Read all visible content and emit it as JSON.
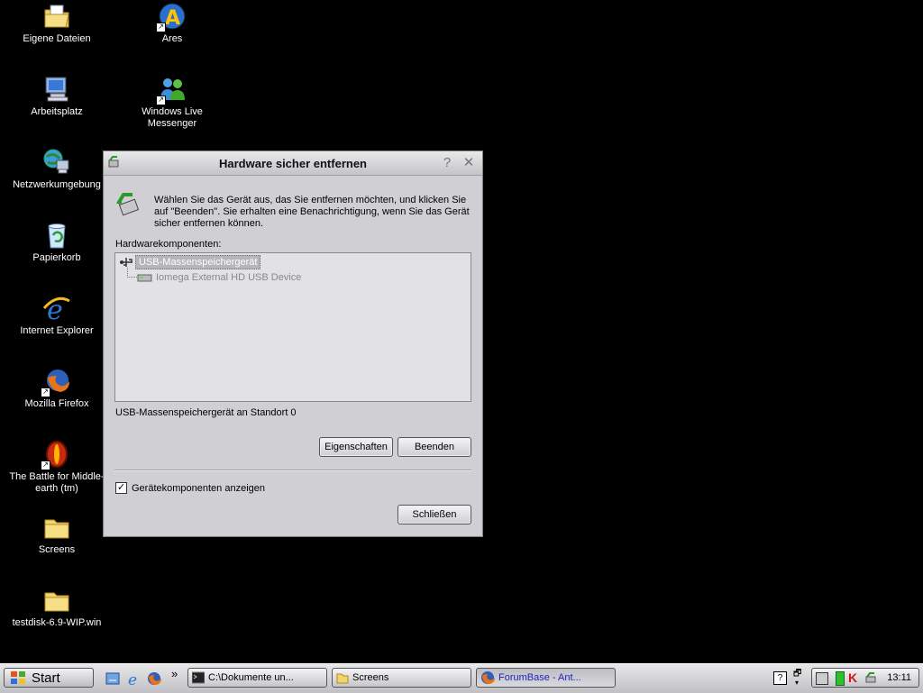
{
  "desktop": {
    "icons": [
      {
        "label": "Eigene Dateien",
        "icon": "folder-documents-icon"
      },
      {
        "label": "Arbeitsplatz",
        "icon": "computer-icon"
      },
      {
        "label": "Netzwerkumgebung",
        "icon": "network-icon"
      },
      {
        "label": "Papierkorb",
        "icon": "recycle-bin-icon"
      },
      {
        "label": "Internet Explorer",
        "icon": "ie-icon"
      },
      {
        "label": "Mozilla Firefox",
        "icon": "firefox-icon"
      },
      {
        "label": "The Battle for Middle-earth (tm)",
        "icon": "game-icon"
      },
      {
        "label": "Screens",
        "icon": "folder-icon"
      },
      {
        "label": "testdisk-6.9-WIP.win",
        "icon": "folder-icon"
      },
      {
        "label": "Ares",
        "icon": "ares-icon"
      },
      {
        "label": "Windows Live Messenger",
        "icon": "messenger-icon"
      }
    ]
  },
  "dialog": {
    "title": "Hardware sicher entfernen",
    "help_glyph": "?",
    "close_glyph": "✕",
    "intro": "Wählen Sie das Gerät aus, das Sie entfernen möchten, und klicken Sie auf \"Beenden\". Sie erhalten eine Benachrichtigung, wenn Sie das Gerät sicher entfernen können.",
    "hardware_label": "Hardwarekomponenten:",
    "tree": {
      "device": "USB-Massenspeichergerät",
      "child": "Iomega External HD USB Device"
    },
    "status": "USB-Massenspeichergerät an Standort 0",
    "properties_button": "Eigenschaften",
    "stop_button": "Beenden",
    "checkbox_label": "Gerätekomponenten anzeigen",
    "checkbox_checked": true,
    "checkbox_mark": "✓",
    "close_button": "Schließen"
  },
  "taskbar": {
    "start_label": "Start",
    "chevron": "»",
    "tasks": [
      {
        "label": "C:\\Dokumente un...",
        "icon": "cmd-icon",
        "active": false
      },
      {
        "label": "Screens",
        "icon": "folder-icon",
        "active": false
      },
      {
        "label": "ForumBase - Ant...",
        "icon": "firefox-icon",
        "active": true
      }
    ],
    "clock": "13:11"
  }
}
